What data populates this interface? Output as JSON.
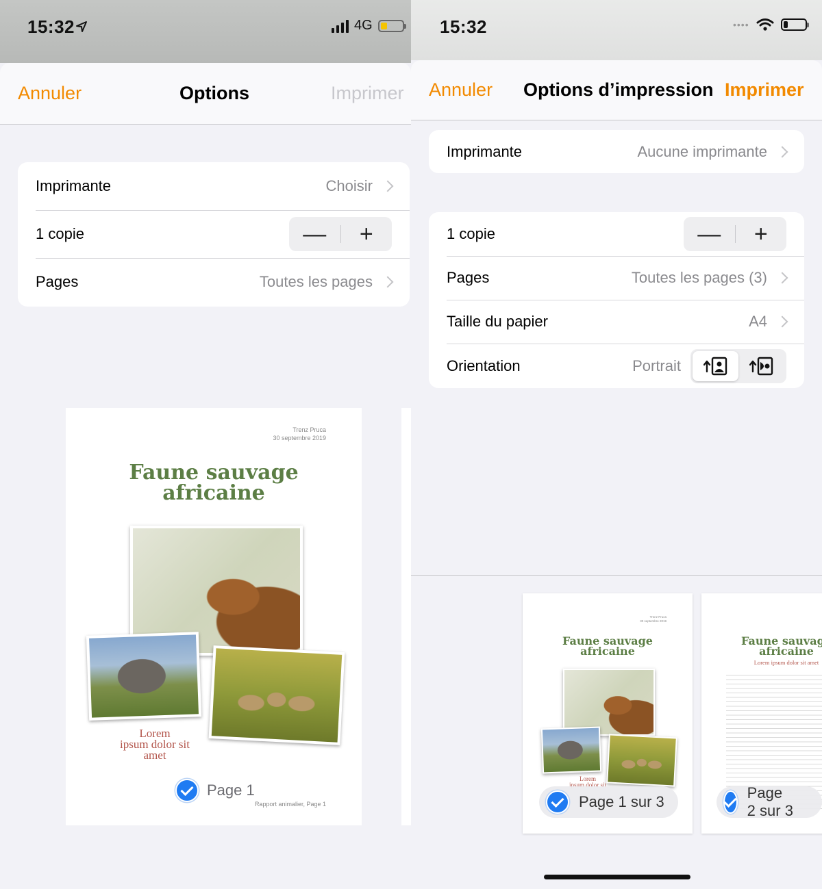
{
  "left": {
    "status": {
      "time": "15:32",
      "network": "4G"
    },
    "header": {
      "cancel": "Annuler",
      "title": "Options",
      "print": "Imprimer"
    },
    "printer": {
      "label": "Imprimante",
      "value": "Choisir"
    },
    "copies": {
      "label": "1 copie",
      "minus": "—",
      "plus": "+"
    },
    "pages": {
      "label": "Pages",
      "value": "Toutes les pages"
    },
    "preview": {
      "author": "Trenz Pruca",
      "date": "30 septembre 2019",
      "title_line1": "Faune sauvage",
      "title_line2": "africaine",
      "lorem_line1": "Lorem",
      "lorem_line2": "ipsum dolor sit",
      "lorem_line3": "amet",
      "page_label": "Page 1",
      "footer": "Rapport animalier, Page 1"
    }
  },
  "right": {
    "status": {
      "time": "15:32"
    },
    "header": {
      "cancel": "Annuler",
      "title": "Options d’impression",
      "print": "Imprimer"
    },
    "printer": {
      "label": "Imprimante",
      "value": "Aucune imprimante"
    },
    "copies": {
      "label": "1 copie",
      "minus": "—",
      "plus": "+"
    },
    "pages": {
      "label": "Pages",
      "value": "Toutes les pages (3)"
    },
    "paper": {
      "label": "Taille du papier",
      "value": "A4"
    },
    "orientation": {
      "label": "Orientation",
      "value": "Portrait",
      "selected": "portrait"
    },
    "thumb1": {
      "author": "Trenz Pruca",
      "date": "30 septembre 2019",
      "title_line1": "Faune sauvage",
      "title_line2": "africaine",
      "lorem": "Lorem",
      "lorem2": "ipsum dolor sit",
      "pill": "Page 1 sur 3"
    },
    "thumb2": {
      "title_line1": "Faune sauvage",
      "title_line2": "africaine",
      "subtitle": "Lorem ipsum dolor sit amet",
      "pill": "Page 2 sur 3"
    }
  },
  "colors": {
    "accent": "#f28a00",
    "title_green": "#5c7e45",
    "lorem_red": "#b2544a",
    "check_blue": "#1f7bf2"
  }
}
